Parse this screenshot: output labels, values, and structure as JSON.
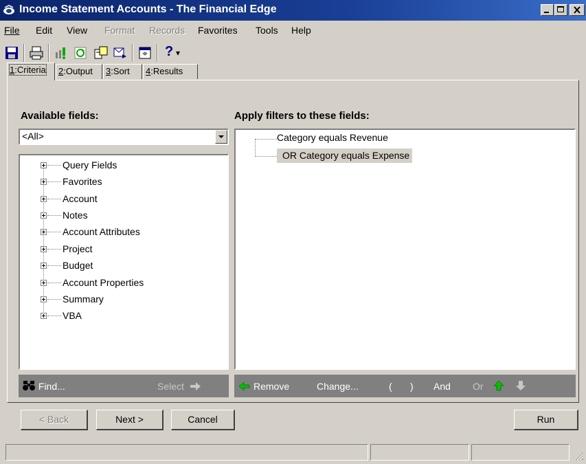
{
  "window": {
    "title": "Income Statement Accounts - The Financial Edge",
    "icon": "app-icon",
    "controls": [
      "minimize-icon",
      "maximize-icon",
      "close-icon"
    ]
  },
  "menu": [
    {
      "label": "File",
      "enabled": true
    },
    {
      "label": "Edit",
      "enabled": true
    },
    {
      "label": "View",
      "enabled": true
    },
    {
      "label": "Format",
      "enabled": false
    },
    {
      "label": "Records",
      "enabled": false
    },
    {
      "label": "Favorites",
      "enabled": true
    },
    {
      "label": "Tools",
      "enabled": true
    },
    {
      "label": "Help",
      "enabled": true
    }
  ],
  "toolbar": {
    "icons": [
      "save-icon",
      "print-icon",
      "process-icon",
      "refresh-icon",
      "export-icon",
      "send-icon",
      "properties-icon",
      "help-icon"
    ],
    "help_glyph": "?"
  },
  "tabs": [
    {
      "key": "1",
      "label": ":Criteria",
      "active": true
    },
    {
      "key": "2",
      "label": ":Output",
      "active": false
    },
    {
      "key": "3",
      "label": ":Sort",
      "active": false
    },
    {
      "key": "4",
      "label": ":Results",
      "active": false
    }
  ],
  "available": {
    "header": "Available fields:",
    "dropdown_value": "<All>",
    "tree": [
      "Query Fields",
      "Favorites",
      "Account",
      "Notes",
      "Account Attributes",
      "Project",
      "Budget",
      "Account Properties",
      "Summary",
      "VBA"
    ]
  },
  "filters": {
    "header": "Apply filters to these fields:",
    "rows": [
      "Category equals Revenue",
      "OR Category equals Expense"
    ],
    "selected_index": 1
  },
  "left_actions": {
    "find": "Find...",
    "select": "Select"
  },
  "right_actions": {
    "remove": "Remove",
    "change": "Change...",
    "open_paren": "(",
    "close_paren": ")",
    "and": "And",
    "or": "Or"
  },
  "buttons": {
    "back": "< Back",
    "next": "Next >",
    "cancel": "Cancel",
    "run": "Run"
  },
  "colors": {
    "titlebar": "#0a246a",
    "face": "#d4d0c8",
    "action_bar": "#808080",
    "selection": "#d4d0c8"
  }
}
